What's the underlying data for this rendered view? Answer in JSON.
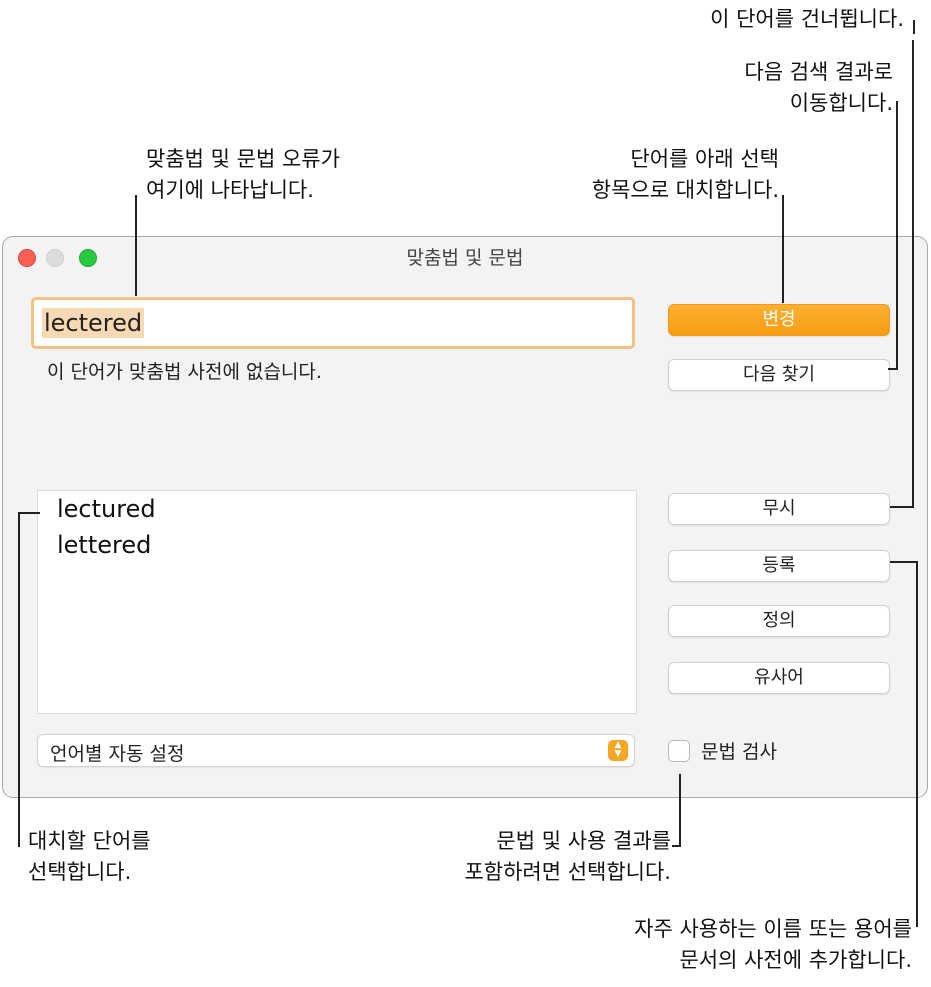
{
  "window": {
    "title": "맞춤법 및 문법",
    "misspelled_word": "lectered",
    "status_message": "이 단어가 맞춤법 사전에 없습니다.",
    "suggestions": [
      "lectured",
      "lettered"
    ],
    "language_popup": "언어별 자동 설정",
    "buttons": {
      "change": "변경",
      "find_next": "다음 찾기",
      "ignore": "무시",
      "learn": "등록",
      "define": "정의",
      "thesaurus": "유사어"
    },
    "grammar_check": {
      "label": "문법 검사",
      "checked": false
    },
    "accent_color": "#f79c14"
  },
  "callouts": {
    "skip_word": "이 단어를 건너뜁니다.",
    "next_result": [
      "다음 검색 결과로",
      "이동합니다."
    ],
    "errors_here": [
      "맞춤법 및 문법 오류가",
      "여기에 나타납니다."
    ],
    "replace_word": [
      "단어를 아래 선택",
      "항목으로 대치합니다."
    ],
    "choose_replacement": [
      "대치할 단어를",
      "선택합니다."
    ],
    "include_grammar": [
      "문법 및 사용 결과를",
      "포함하려면 선택합니다."
    ],
    "add_to_dictionary": [
      "자주 사용하는 이름 또는 용어를",
      "문서의 사전에 추가합니다."
    ]
  }
}
